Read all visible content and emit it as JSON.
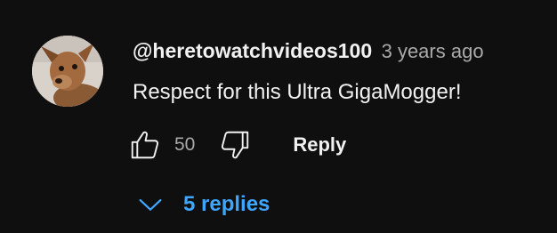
{
  "comment": {
    "author": "@heretowatchvideos100",
    "timestamp": "3 years ago",
    "text": "Respect for this Ultra GigaMogger!",
    "like_count": "50",
    "reply_label": "Reply"
  },
  "replies": {
    "label": "5 replies"
  },
  "icons": {
    "like": "thumbs-up-icon",
    "dislike": "thumbs-down-icon",
    "expand": "chevron-down-icon"
  },
  "colors": {
    "background": "#0f0f0f",
    "text_primary": "#f1f1f1",
    "text_secondary": "#aaaaaa",
    "link_blue": "#3ea6ff"
  }
}
